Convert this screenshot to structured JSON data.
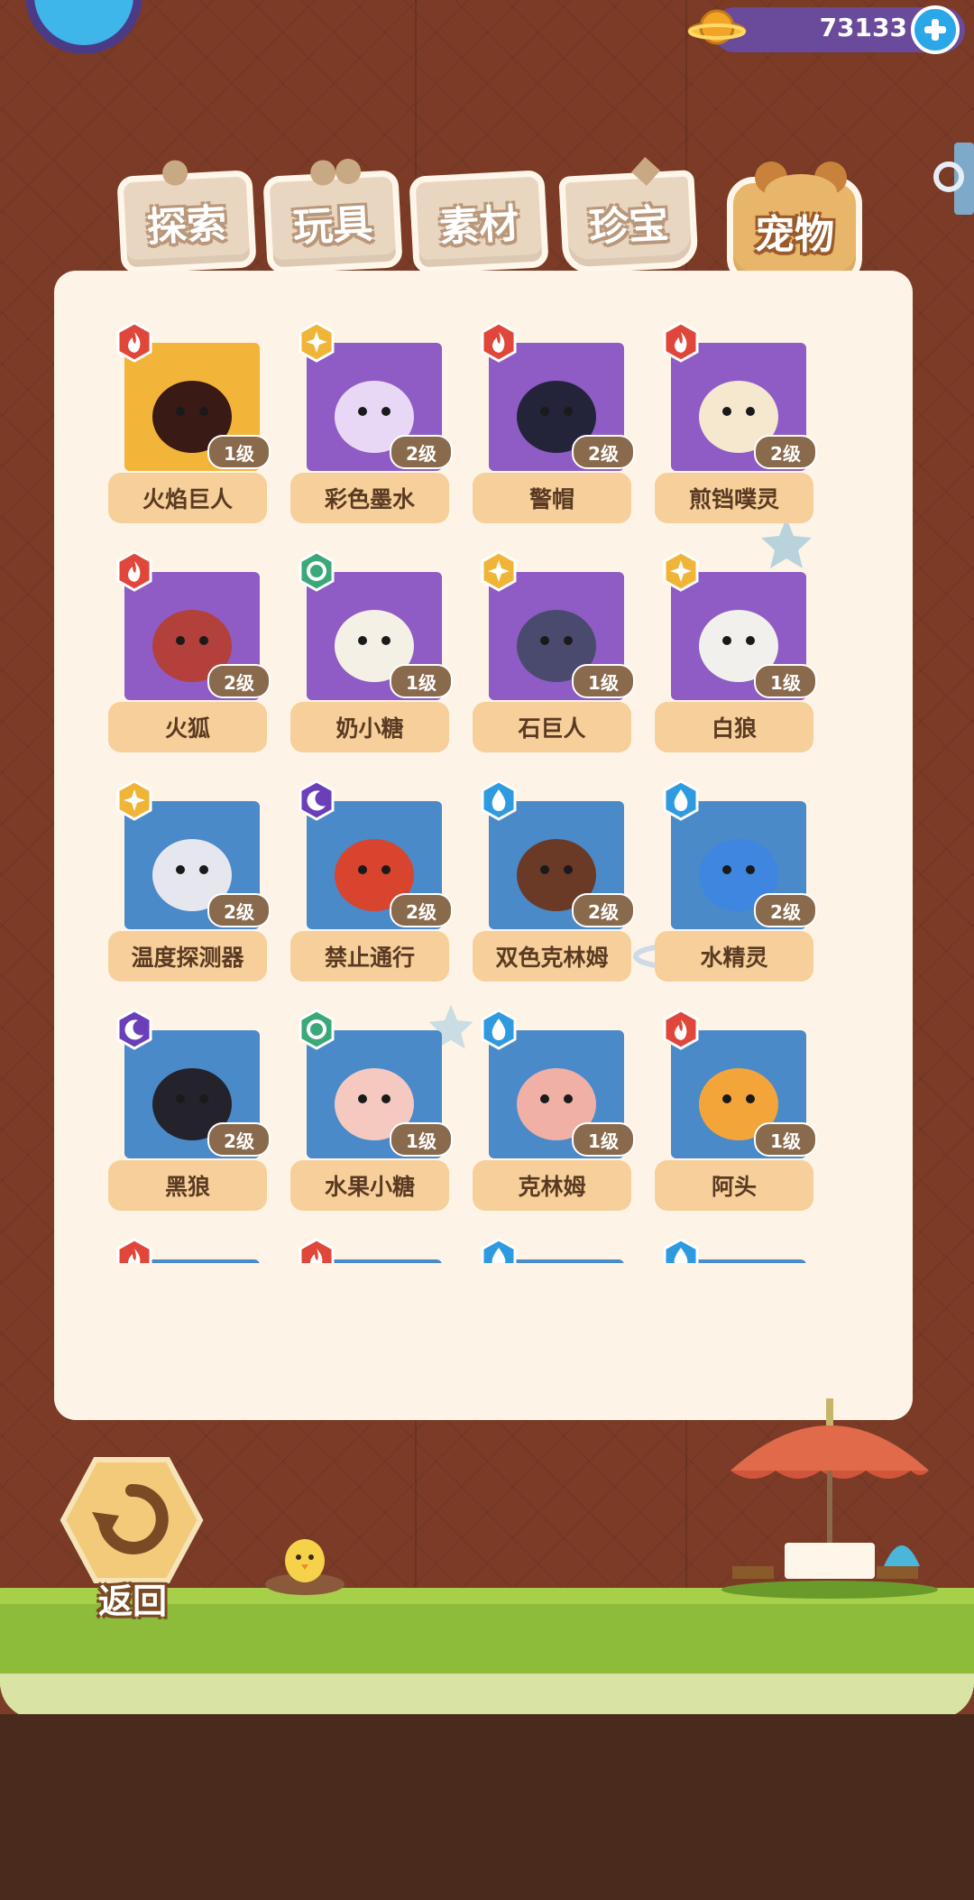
{
  "currency": {
    "value": "73133"
  },
  "tabs": [
    {
      "label": "探索",
      "active": false
    },
    {
      "label": "玩具",
      "active": false
    },
    {
      "label": "素材",
      "active": false
    },
    {
      "label": "珍宝",
      "active": false
    },
    {
      "label": "宠物",
      "active": true
    }
  ],
  "pets": [
    {
      "name": "火焰巨人",
      "level": "1级",
      "element": "fire",
      "bg": "#f2b53a",
      "body": "#3a1a14"
    },
    {
      "name": "彩色墨水",
      "level": "2级",
      "element": "star",
      "bg": "#8e5cc4",
      "body": "#e9d8f5"
    },
    {
      "name": "警帽",
      "level": "2级",
      "element": "fire",
      "bg": "#8e5cc4",
      "body": "#23233a"
    },
    {
      "name": "煎铛噗灵",
      "level": "2级",
      "element": "fire",
      "bg": "#8e5cc4",
      "body": "#f6e7cf"
    },
    {
      "name": "火狐",
      "level": "2级",
      "element": "fire",
      "bg": "#8e5cc4",
      "body": "#b3403a"
    },
    {
      "name": "奶小糖",
      "level": "1级",
      "element": "leaf",
      "bg": "#8e5cc4",
      "body": "#f4f0e6"
    },
    {
      "name": "石巨人",
      "level": "1级",
      "element": "star",
      "bg": "#8e5cc4",
      "body": "#4a4a6e"
    },
    {
      "name": "白狼",
      "level": "1级",
      "element": "star",
      "bg": "#8e5cc4",
      "body": "#f2f0ec"
    },
    {
      "name": "温度探测器",
      "level": "2级",
      "element": "star",
      "bg": "#4a8ac8",
      "body": "#e6e6ee"
    },
    {
      "name": "禁止通行",
      "level": "2级",
      "element": "moon",
      "bg": "#4a8ac8",
      "body": "#d8442e"
    },
    {
      "name": "双色克林姆",
      "level": "2级",
      "element": "water",
      "bg": "#4a8ac8",
      "body": "#6a3a26"
    },
    {
      "name": "水精灵",
      "level": "2级",
      "element": "water",
      "bg": "#4a8ac8",
      "body": "#3f86e0"
    },
    {
      "name": "黑狼",
      "level": "2级",
      "element": "moon",
      "bg": "#4a8ac8",
      "body": "#24222a"
    },
    {
      "name": "水果小糖",
      "level": "1级",
      "element": "leaf",
      "bg": "#4a8ac8",
      "body": "#f6c9c0"
    },
    {
      "name": "克林姆",
      "level": "1级",
      "element": "water",
      "bg": "#4a8ac8",
      "body": "#f0b0a6"
    },
    {
      "name": "阿头",
      "level": "1级",
      "element": "fire",
      "bg": "#4a8ac8",
      "body": "#f3a53a"
    },
    {
      "name": "",
      "level": "",
      "element": "fire",
      "bg": "#4a8ac8",
      "body": "#4a8ac8"
    },
    {
      "name": "",
      "level": "",
      "element": "fire",
      "bg": "#4a8ac8",
      "body": "#4a8ac8"
    },
    {
      "name": "",
      "level": "",
      "element": "water",
      "bg": "#4a8ac8",
      "body": "#4a8ac8"
    },
    {
      "name": "",
      "level": "",
      "element": "water",
      "bg": "#4a8ac8",
      "body": "#4a8ac8"
    }
  ],
  "element_colors": {
    "fire": "#e0463a",
    "star": "#f0b437",
    "leaf": "#3aa878",
    "moon": "#6a3fb8",
    "water": "#2f9ae0"
  },
  "return_button": {
    "label": "返回"
  }
}
